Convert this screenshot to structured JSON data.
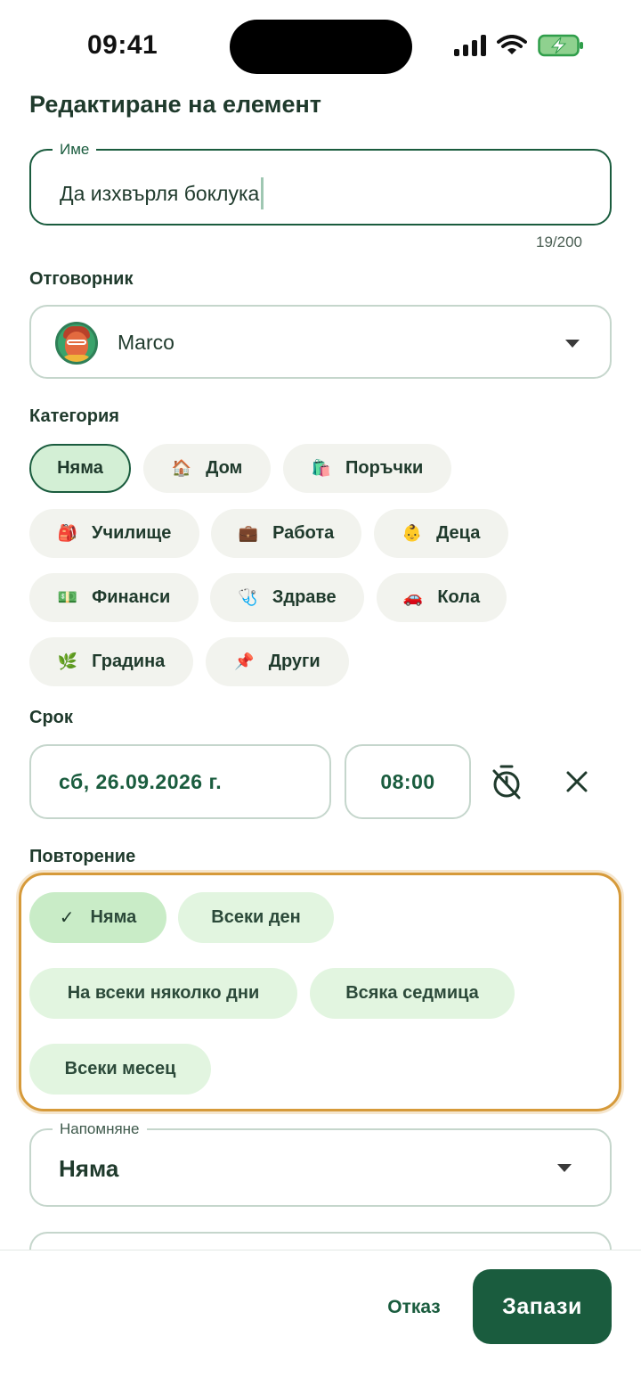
{
  "status_bar": {
    "time": "09:41"
  },
  "page_title": "Редактиране на елемент",
  "name_field": {
    "label": "Име",
    "value": "Да изхвърля боклука",
    "counter": "19/200"
  },
  "assignee": {
    "label": "Отговорник",
    "value": "Marco",
    "icon": "chevron-down-icon"
  },
  "category": {
    "label": "Категория",
    "selected": "Няма",
    "items": [
      {
        "label": "Няма",
        "icon": ""
      },
      {
        "label": "Дом",
        "icon": "🏠"
      },
      {
        "label": "Поръчки",
        "icon": "🛍️"
      },
      {
        "label": "Училище",
        "icon": "🎒"
      },
      {
        "label": "Работа",
        "icon": "💼"
      },
      {
        "label": "Деца",
        "icon": "👶"
      },
      {
        "label": "Финанси",
        "icon": "💵"
      },
      {
        "label": "Здраве",
        "icon": "🩺"
      },
      {
        "label": "Кола",
        "icon": "🚗"
      },
      {
        "label": "Градина",
        "icon": "🌿"
      },
      {
        "label": "Други",
        "icon": "📌"
      }
    ]
  },
  "deadline": {
    "label": "Срок",
    "date": "сб, 26.09.2026 г.",
    "time": "08:00"
  },
  "repeat": {
    "label": "Повторение",
    "selected": "Няма",
    "items": [
      {
        "label": "Няма"
      },
      {
        "label": "Всеки ден"
      },
      {
        "label": "На всеки няколко дни"
      },
      {
        "label": "Всяка седмица"
      },
      {
        "label": "Всеки месец"
      }
    ]
  },
  "reminder": {
    "label": "Напомняне",
    "value": "Няма"
  },
  "actions": {
    "cancel": "Отказ",
    "save": "Запази"
  },
  "colors": {
    "primary": "#1a5c3e",
    "chip_bg": "#f2f3ee",
    "repeat_chip_bg": "#e2f5e0",
    "highlight": "#d69a3a"
  }
}
